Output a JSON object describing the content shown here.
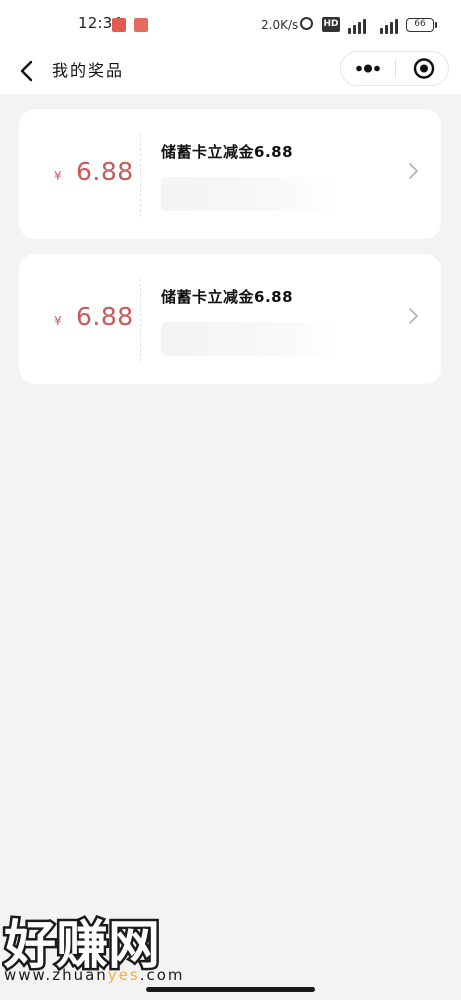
{
  "status_bar": {
    "time": "12:34",
    "net_speed": "2.0K/s",
    "hd_label": "HD",
    "battery": "66"
  },
  "nav": {
    "title": "我的奖品",
    "back_icon": "chevron-left-icon",
    "more_icon": "more-dots-icon",
    "close_icon": "target-close-icon"
  },
  "prizes": [
    {
      "currency": "¥",
      "amount": "6.88",
      "title": "储蓄卡立减金6.88"
    },
    {
      "currency": "¥",
      "amount": "6.88",
      "title": "储蓄卡立减金6.88"
    }
  ],
  "watermark": {
    "logo": "好赚网",
    "url_prefix": "www.zhuan",
    "url_highlight": "yes",
    "url_suffix": ".com"
  },
  "colors": {
    "amount": "#c95a5a",
    "background": "#f3f3f3",
    "card": "#ffffff",
    "watermark_highlight": "#f2b23d"
  }
}
